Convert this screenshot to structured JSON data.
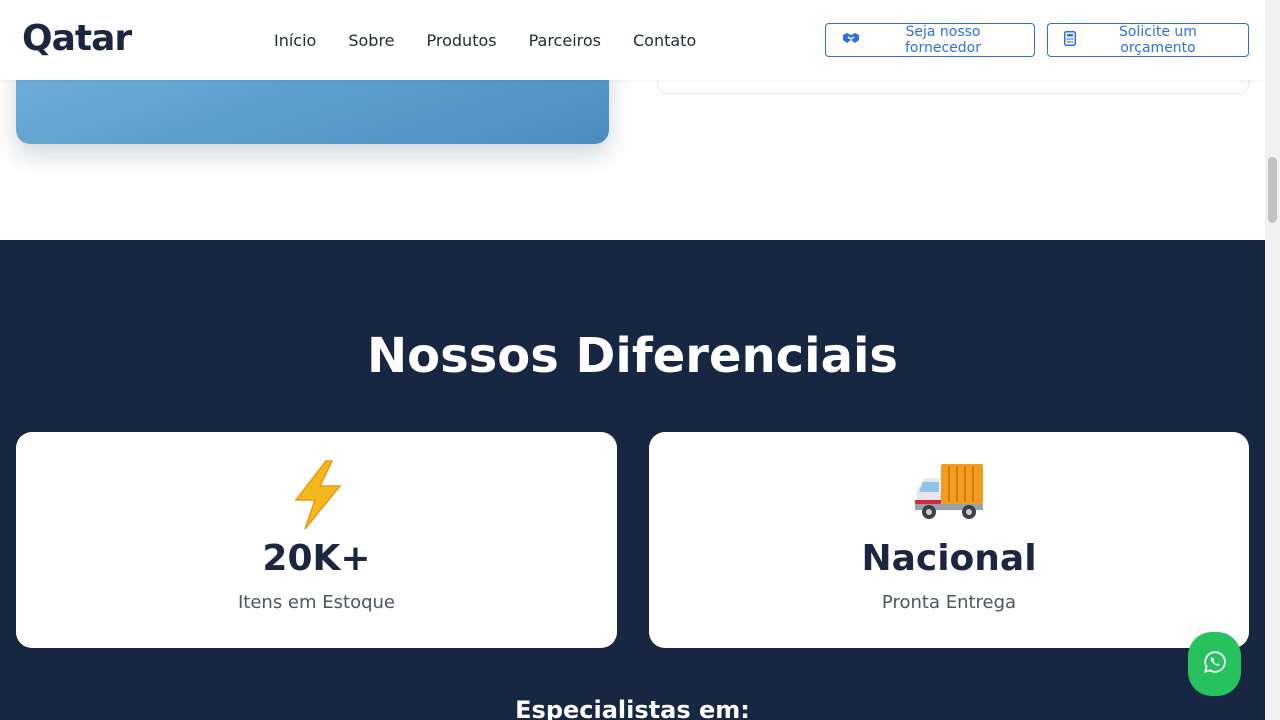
{
  "header": {
    "logo": "Qatar",
    "nav": [
      {
        "label": "Início"
      },
      {
        "label": "Sobre"
      },
      {
        "label": "Produtos"
      },
      {
        "label": "Parceiros"
      },
      {
        "label": "Contato"
      }
    ],
    "supplier_button": "Seja nosso fornecedor",
    "quote_button": "Solicite um orçamento"
  },
  "features": {
    "title": "Nossos Diferenciais",
    "cards": [
      {
        "icon": "lightning-icon",
        "value": "20K+",
        "label": "Itens em Estoque"
      },
      {
        "icon": "delivery-truck-icon",
        "value": "Nacional",
        "label": "Pronta Entrega"
      }
    ],
    "specialists_title": "Especialistas em:"
  },
  "colors": {
    "brand_dark": "#172641",
    "accent_blue": "#2f6fe0",
    "whatsapp_green": "#25c25e"
  }
}
